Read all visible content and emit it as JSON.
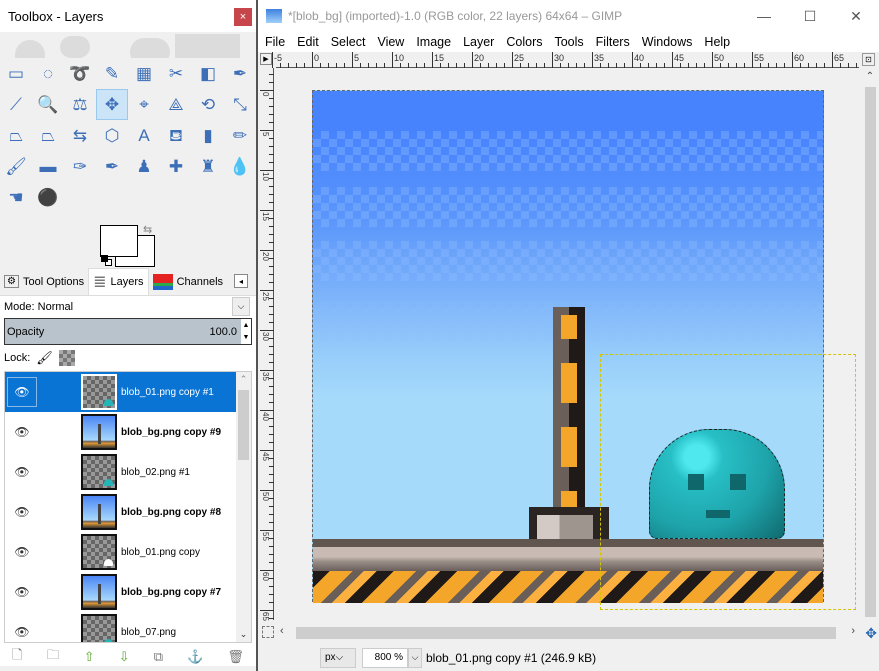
{
  "toolbox": {
    "title": "Toolbox - Layers",
    "close_label": "×",
    "tools": [
      {
        "name": "rect-select-icon",
        "glyph": "▭"
      },
      {
        "name": "ellipse-select-icon",
        "glyph": "◌"
      },
      {
        "name": "free-select-icon",
        "glyph": "➰"
      },
      {
        "name": "fuzzy-select-icon",
        "glyph": "✎"
      },
      {
        "name": "select-by-color-icon",
        "glyph": "▦"
      },
      {
        "name": "scissors-select-icon",
        "glyph": "✂"
      },
      {
        "name": "foreground-select-icon",
        "glyph": "◧"
      },
      {
        "name": "paths-icon",
        "glyph": "✒"
      },
      {
        "name": "color-picker-icon",
        "glyph": "⟋"
      },
      {
        "name": "zoom-icon",
        "glyph": "🔍"
      },
      {
        "name": "measure-icon",
        "glyph": "⚖"
      },
      {
        "name": "move-icon",
        "glyph": "✥"
      },
      {
        "name": "align-icon",
        "glyph": "⌖"
      },
      {
        "name": "crop-icon",
        "glyph": "⟁"
      },
      {
        "name": "rotate-icon",
        "glyph": "⟲"
      },
      {
        "name": "scale-icon",
        "glyph": "⤡"
      },
      {
        "name": "shear-icon",
        "glyph": "⏢"
      },
      {
        "name": "perspective-icon",
        "glyph": "⏢"
      },
      {
        "name": "flip-icon",
        "glyph": "⇆"
      },
      {
        "name": "cage-transform-icon",
        "glyph": "⬡"
      },
      {
        "name": "text-icon",
        "glyph": "A"
      },
      {
        "name": "bucket-fill-icon",
        "glyph": "⛾"
      },
      {
        "name": "blend-icon",
        "glyph": "▮"
      },
      {
        "name": "pencil-icon",
        "glyph": "✏"
      },
      {
        "name": "paintbrush-icon",
        "glyph": "🖌"
      },
      {
        "name": "eraser-icon",
        "glyph": "▬"
      },
      {
        "name": "airbrush-icon",
        "glyph": "✑"
      },
      {
        "name": "ink-icon",
        "glyph": "✒"
      },
      {
        "name": "clone-icon",
        "glyph": "♟"
      },
      {
        "name": "heal-icon",
        "glyph": "✚"
      },
      {
        "name": "perspective-clone-icon",
        "glyph": "♜"
      },
      {
        "name": "blur-sharpen-icon",
        "glyph": "💧"
      },
      {
        "name": "smudge-icon",
        "glyph": "☚"
      },
      {
        "name": "dodge-burn-icon",
        "glyph": "⚫"
      }
    ],
    "active_tool_index": 11,
    "colors": {
      "foreground": "#ffffff",
      "background": "#ffffff"
    },
    "swap_icon": "⇆"
  },
  "dock": {
    "tabs": [
      {
        "label": "Tool Options",
        "icon": "tool-options-icon",
        "glyph": "⚙"
      },
      {
        "label": "Layers",
        "icon": "layers-icon",
        "glyph": "≣"
      },
      {
        "label": "Channels",
        "icon": "channels-icon",
        "glyph": "▤"
      }
    ],
    "active_tab": "Layers",
    "tab_menu_glyph": "◂"
  },
  "layers": {
    "mode_label": "Mode: Normal",
    "opacity_label": "Opacity",
    "opacity_value": "100.0",
    "lock_label": "Lock:",
    "items": [
      {
        "name": "blob_01.png copy #1",
        "bold": false,
        "selected": true,
        "thumb": "blob"
      },
      {
        "name": "blob_bg.png copy #9",
        "bold": true,
        "selected": false,
        "thumb": "bg"
      },
      {
        "name": "blob_02.png #1",
        "bold": false,
        "selected": false,
        "thumb": "blob"
      },
      {
        "name": "blob_bg.png copy #8",
        "bold": true,
        "selected": false,
        "thumb": "bg"
      },
      {
        "name": "blob_01.png copy",
        "bold": false,
        "selected": false,
        "thumb": "blob-white"
      },
      {
        "name": "blob_bg.png copy #7",
        "bold": true,
        "selected": false,
        "thumb": "bg"
      },
      {
        "name": "blob_07.png",
        "bold": false,
        "selected": false,
        "thumb": "blob"
      }
    ],
    "actions": [
      {
        "name": "new-layer-button",
        "glyph": "🗋"
      },
      {
        "name": "new-layer-group-button",
        "glyph": "🗀"
      },
      {
        "name": "raise-layer-button",
        "glyph": "⇧"
      },
      {
        "name": "lower-layer-button",
        "glyph": "⇩"
      },
      {
        "name": "duplicate-layer-button",
        "glyph": "⧉"
      },
      {
        "name": "anchor-layer-button",
        "glyph": "⚓"
      },
      {
        "name": "delete-layer-button",
        "glyph": "🗑"
      }
    ]
  },
  "image_window": {
    "title": "*[blob_bg] (imported)-1.0 (RGB color, 22 layers) 64x64 – GIMP",
    "controls": {
      "minimize": "—",
      "maximize": "☐",
      "close": "✕"
    },
    "menu": [
      "File",
      "Edit",
      "Select",
      "View",
      "Image",
      "Layer",
      "Colors",
      "Tools",
      "Filters",
      "Windows",
      "Help"
    ],
    "ruler_h_labels": [
      "-5",
      "0",
      "5",
      "10",
      "15",
      "20",
      "25",
      "30",
      "35",
      "40",
      "45",
      "50",
      "55",
      "60",
      "65"
    ],
    "ruler_v_labels": [
      "0",
      "5",
      "10",
      "15",
      "20",
      "25",
      "30",
      "35",
      "40",
      "45",
      "50",
      "55",
      "60",
      "65"
    ],
    "status": {
      "unit": "px",
      "zoom": "800 %",
      "info": "blob_01.png copy #1 (246.9 kB)"
    }
  }
}
